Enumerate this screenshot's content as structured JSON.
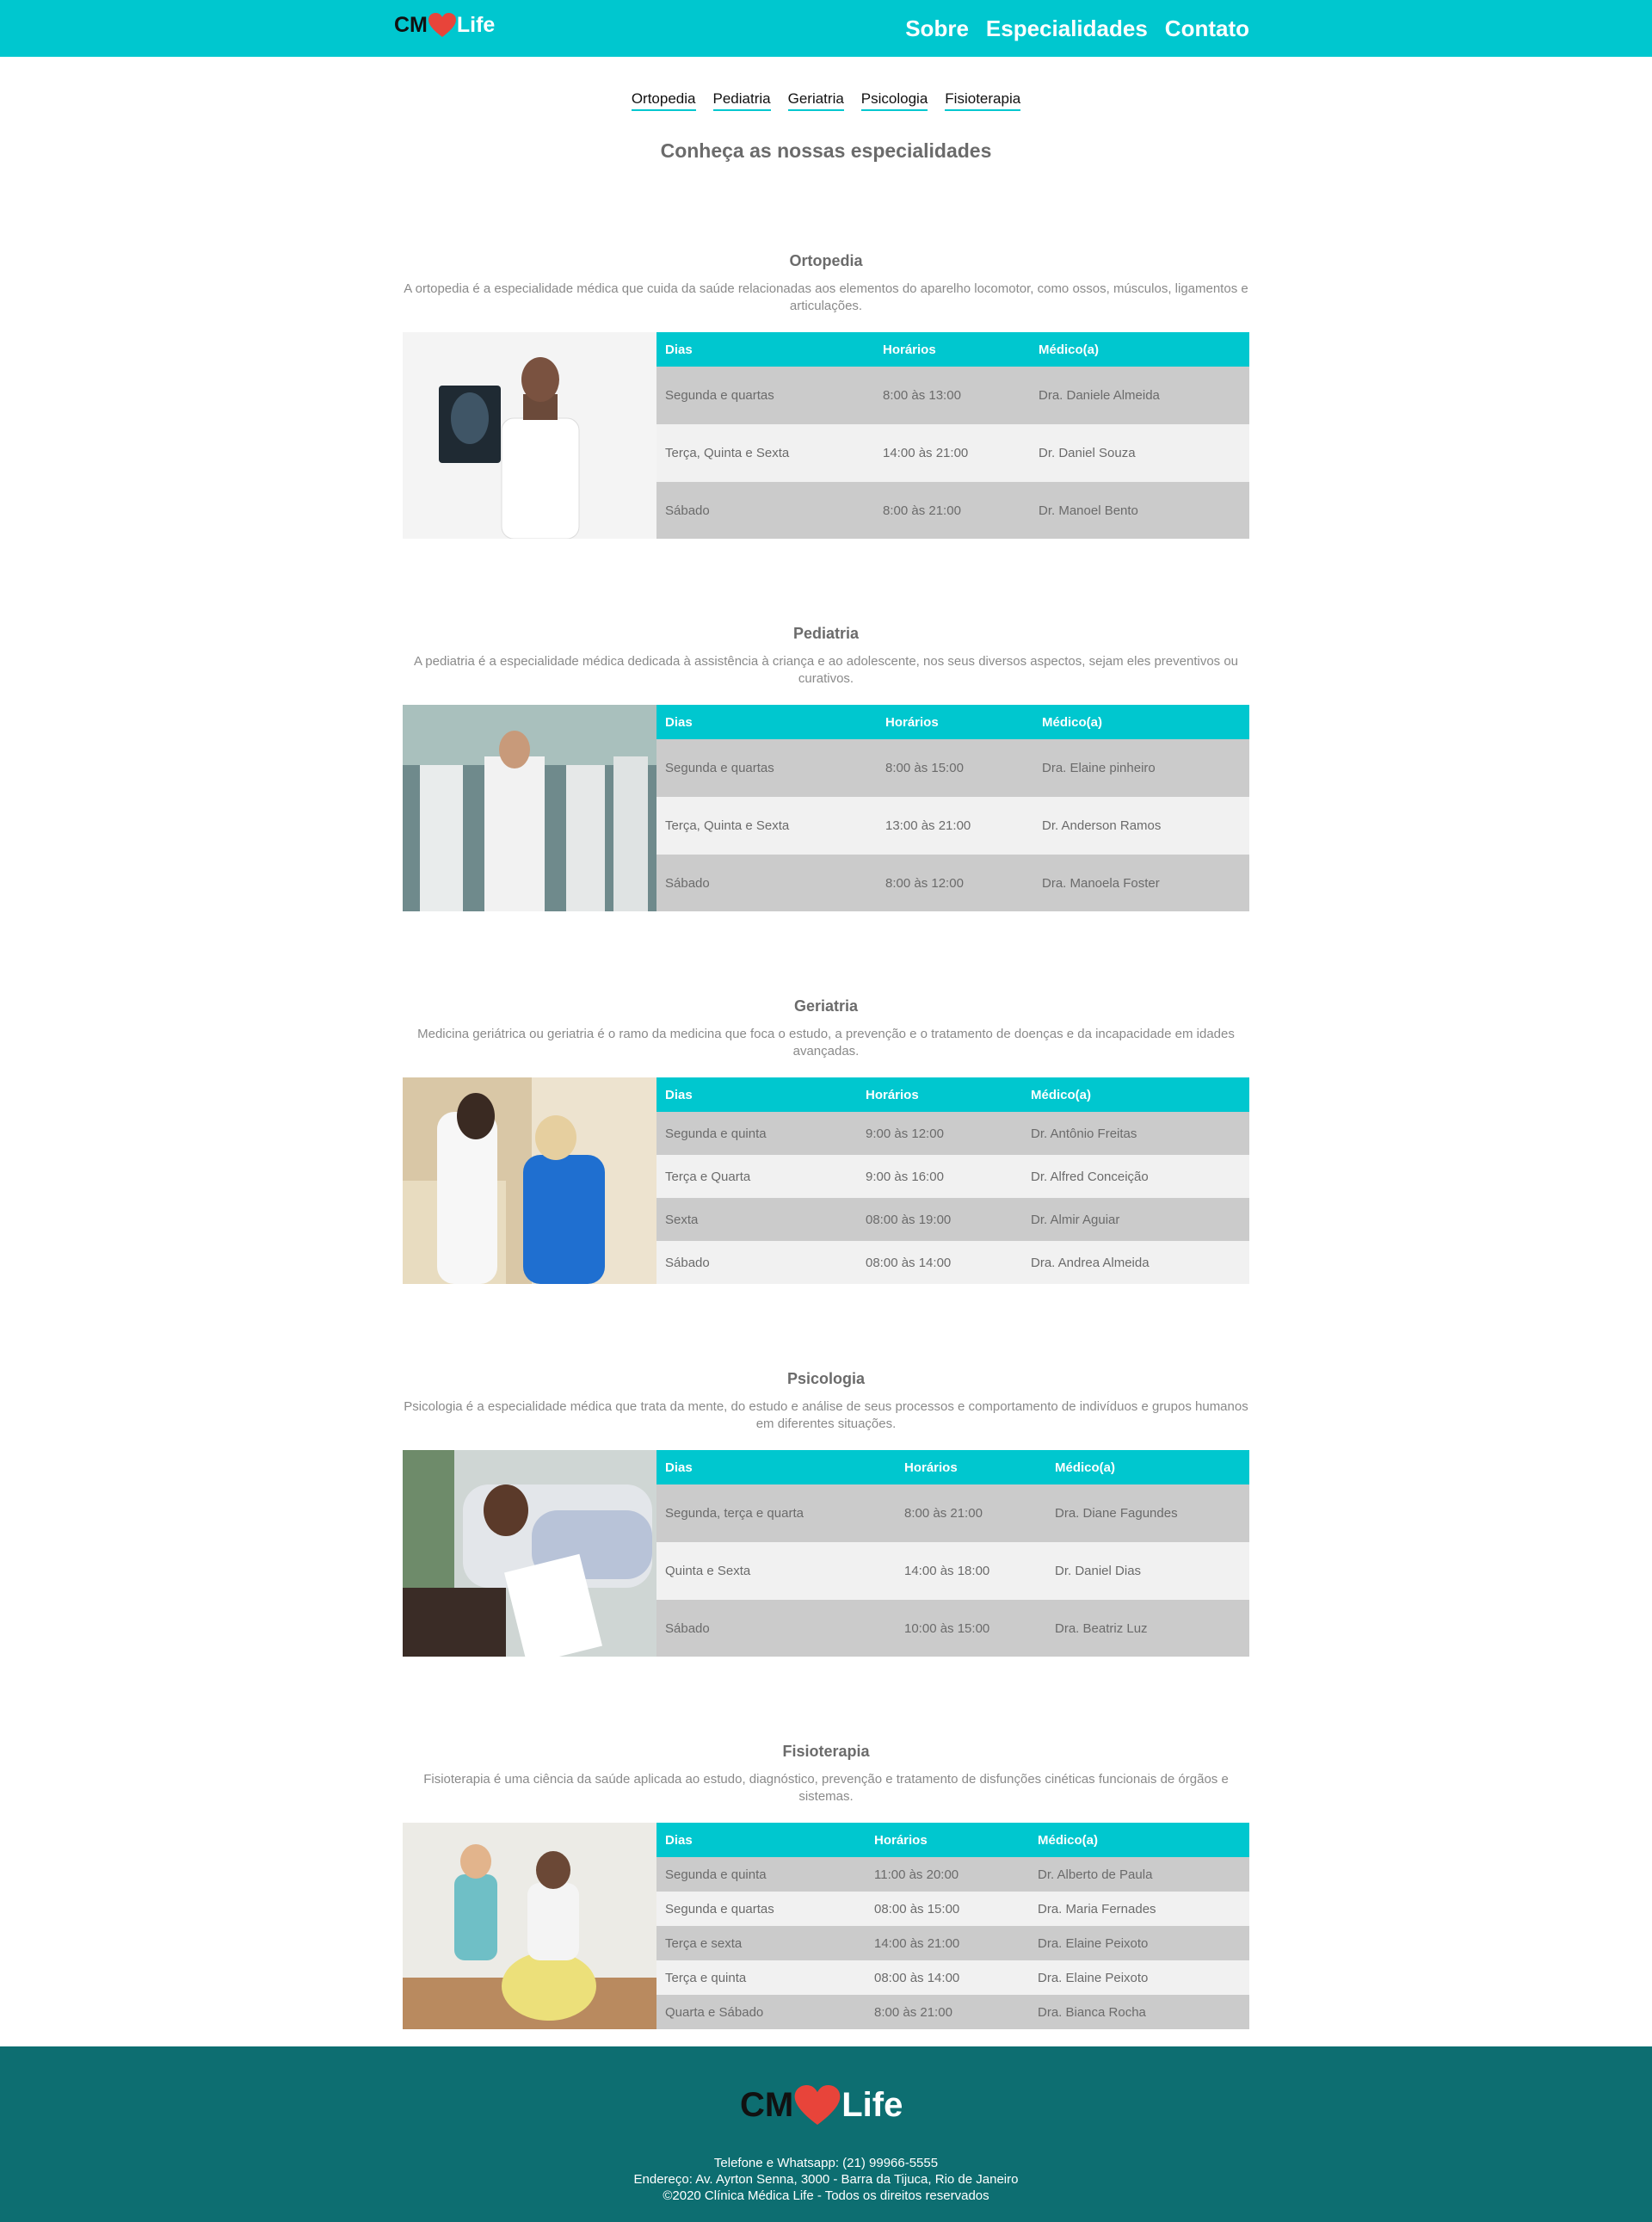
{
  "brand": {
    "prefix": "CM",
    "suffix": "Life",
    "heart_color": "#e8443a",
    "accent": "#00c7cf",
    "footer_bg": "#0d6e71"
  },
  "nav": {
    "items": [
      "Sobre",
      "Especialidades",
      "Contato"
    ]
  },
  "subnav": {
    "items": [
      "Ortopedia",
      "Pediatria",
      "Geriatria",
      "Psicologia",
      "Fisioterapia"
    ]
  },
  "intro": {
    "title": "Conheça as nossas especialidades"
  },
  "table_headers": {
    "days": "Dias",
    "hours": "Horários",
    "doctor": "Médico(a)"
  },
  "sections": [
    {
      "title": "Ortopedia",
      "description": "A ortopedia é a especialidade médica que cuida da saúde relacionadas aos elementos do aparelho locomotor, como ossos, músculos, ligamentos e articulações.",
      "rows": [
        [
          "Segunda e quartas",
          "8:00 às 13:00",
          "Dra. Daniele Almeida"
        ],
        [
          "Terça, Quinta e Sexta",
          "14:00 às 21:00",
          "Dr. Daniel Souza"
        ],
        [
          "Sábado",
          "8:00 às 21:00",
          "Dr. Manoel Bento"
        ]
      ]
    },
    {
      "title": "Pediatria",
      "description": "A pediatria é a especialidade médica dedicada à assistência à criança e ao adolescente, nos seus diversos aspectos, sejam eles preventivos ou curativos.",
      "rows": [
        [
          "Segunda e quartas",
          "8:00 às 15:00",
          "Dra. Elaine pinheiro"
        ],
        [
          "Terça, Quinta e Sexta",
          "13:00 às 21:00",
          "Dr. Anderson Ramos"
        ],
        [
          "Sábado",
          "8:00 às 12:00",
          "Dra. Manoela Foster"
        ]
      ]
    },
    {
      "title": "Geriatria",
      "description": "Medicina geriátrica ou geriatria é o ramo da medicina que foca o estudo, a prevenção e o tratamento de doenças e da incapacidade em idades avançadas.",
      "rows": [
        [
          "Segunda e quinta",
          "9:00 às 12:00",
          "Dr. Antônio Freitas"
        ],
        [
          "Terça e Quarta",
          "9:00 às 16:00",
          "Dr. Alfred Conceição"
        ],
        [
          "Sexta",
          "08:00 às 19:00",
          "Dr. Almir Aguiar"
        ],
        [
          "Sábado",
          "08:00 às 14:00",
          "Dra. Andrea Almeida"
        ]
      ]
    },
    {
      "title": "Psicologia",
      "description": "Psicologia é a especialidade médica que trata da mente, do estudo e análise de seus processos e comportamento de indivíduos e grupos humanos em diferentes situações.",
      "rows": [
        [
          "Segunda, terça e quarta",
          "8:00 às 21:00",
          "Dra. Diane Fagundes"
        ],
        [
          "Quinta e Sexta",
          "14:00 às 18:00",
          "Dr. Daniel Dias"
        ],
        [
          "Sábado",
          "10:00 às 15:00",
          "Dra. Beatriz Luz"
        ]
      ]
    },
    {
      "title": "Fisioterapia",
      "description": "Fisioterapia é uma ciência da saúde aplicada ao estudo, diagnóstico, prevenção e tratamento de disfunções cinéticas funcionais de órgãos e sistemas.",
      "rows": [
        [
          "Segunda e quinta",
          "11:00 às 20:00",
          "Dr. Alberto de Paula"
        ],
        [
          "Segunda e quartas",
          "08:00 às 15:00",
          "Dra. Maria Fernades"
        ],
        [
          "Terça e sexta",
          "14:00 às 21:00",
          "Dra. Elaine Peixoto"
        ],
        [
          "Terça e quinta",
          "08:00 às 14:00",
          "Dra. Elaine Peixoto"
        ],
        [
          "Quarta e Sábado",
          "8:00 às 21:00",
          "Dra. Bianca Rocha"
        ]
      ]
    }
  ],
  "footer": {
    "phone": "Telefone e Whatsapp: (21) 99966-5555",
    "address": "Endereço: Av. Ayrton Senna, 3000 - Barra da Tijuca, Rio de Janeiro",
    "copyright": "©2020 Clínica Médica Life - Todos os direitos reservados"
  }
}
